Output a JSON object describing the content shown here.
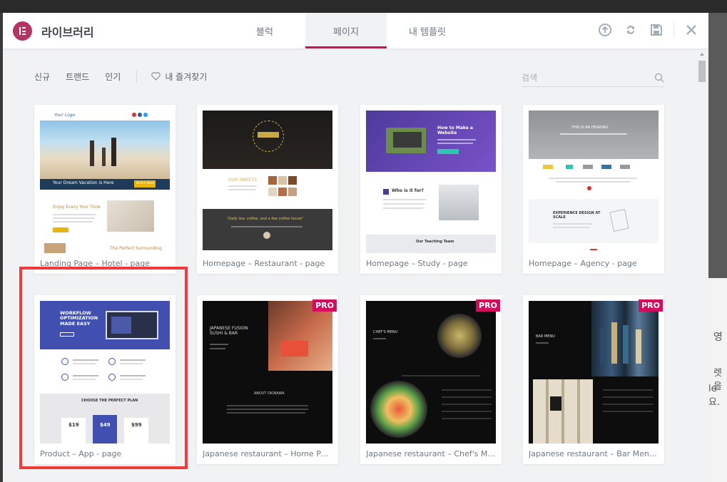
{
  "header": {
    "title": "라이브러리",
    "tabs": [
      {
        "label": "블럭",
        "active": false
      },
      {
        "label": "페이지",
        "active": true
      },
      {
        "label": "내 템플릿",
        "active": false
      }
    ],
    "accent_color": "#d30c5c",
    "logo_color": "#b43466",
    "icons": [
      "upload-icon",
      "sync-icon",
      "save-icon",
      "close-icon"
    ]
  },
  "filters": {
    "items": [
      "신규",
      "트랜드",
      "인기"
    ],
    "favorites": "내 즐겨찾기"
  },
  "search": {
    "placeholder": "검색"
  },
  "background": {
    "right_text_1": "영",
    "right_text_2": "렛을",
    "right_text_3": "le 요."
  },
  "templates": [
    {
      "caption": "Landing Page – Hotel - page",
      "pro": false,
      "preview": {
        "logo": "Your Logo",
        "banner": "Your Dream Vacation is Here",
        "button": "Book it Now!",
        "heading": "Enjoy Every Your Time",
        "section": "The Perfect Surrounding"
      }
    },
    {
      "caption": "Homepage – Restaurant - page",
      "pro": false,
      "preview": {
        "section": "OUR SWEETS",
        "quote": "\"Daily tea, coffee, and a few coffee house\""
      }
    },
    {
      "caption": "Homepage – Study - page",
      "pro": false,
      "preview": {
        "hero": "How to Make a Website",
        "who": "Who is it for?",
        "team": "Our Teaching Team"
      }
    },
    {
      "caption": "Homepage – Agency - page",
      "pro": false,
      "preview": {
        "hero": "THIS IS AN HEADING",
        "section": "EXPERIENCE DESIGN AT SCALE"
      }
    },
    {
      "caption": "Product – App - page",
      "pro": false,
      "preview": {
        "hero": "WORKFLOW OPTIMIZATION MADE EASY",
        "plan": "CHOOSE THE PERFECT PLAN",
        "prices": [
          "$19",
          "$49",
          "$99"
        ]
      }
    },
    {
      "caption": "Japanese restaurant – Home Page",
      "pro": true,
      "preview": {
        "hero": "JAPANESE FUSION SUSHI & BAR",
        "about": "ABOUT OKINAWA"
      }
    },
    {
      "caption": "Japanese restaurant – Chef's Menu",
      "pro": true,
      "preview": {
        "hero": "CHEF'S MENU"
      }
    },
    {
      "caption": "Japanese restaurant – Bar Menu - page",
      "pro": true,
      "preview": {
        "hero": "BAR MENU"
      }
    }
  ],
  "pro_label": "PRO",
  "selected_template_index": 4
}
